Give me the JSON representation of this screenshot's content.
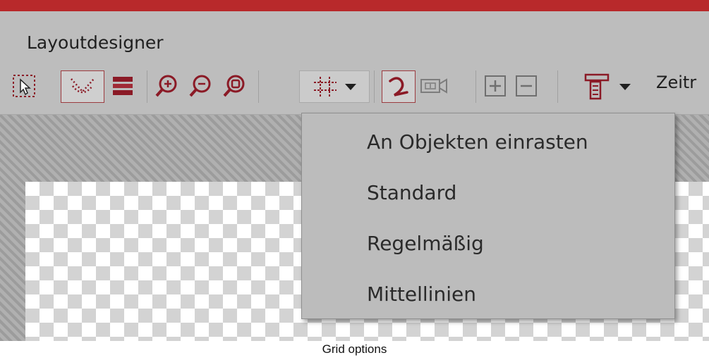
{
  "window": {
    "title": "Layoutdesigner"
  },
  "toolbar": {
    "buttons": [
      {
        "name": "select-tool",
        "icon": "select-arrow-icon"
      },
      {
        "name": "motion-path",
        "icon": "dotted-path-icon"
      },
      {
        "name": "layers",
        "icon": "layers-icon"
      },
      {
        "name": "zoom-in",
        "icon": "zoom-in-icon"
      },
      {
        "name": "zoom-out",
        "icon": "zoom-out-icon"
      },
      {
        "name": "zoom-fit",
        "icon": "zoom-fit-icon"
      },
      {
        "name": "grid-options",
        "icon": "grid-icon"
      },
      {
        "name": "curve",
        "icon": "curve-icon"
      },
      {
        "name": "camera",
        "icon": "camera-icon"
      },
      {
        "name": "add",
        "icon": "plus-icon"
      },
      {
        "name": "remove",
        "icon": "minus-icon"
      },
      {
        "name": "timeline-options",
        "icon": "timeline-icon"
      }
    ],
    "trailing_label": "Zeitr"
  },
  "grid_menu": {
    "items": [
      {
        "label": "An Objekten einrasten"
      },
      {
        "label": "Standard"
      },
      {
        "label": "Regelmäßig"
      },
      {
        "label": "Mittellinien"
      }
    ]
  },
  "caption": "Grid options",
  "colors": {
    "accent": "#b8292b",
    "icon": "#8b1a26",
    "toolbar": "#bdbdbd"
  }
}
